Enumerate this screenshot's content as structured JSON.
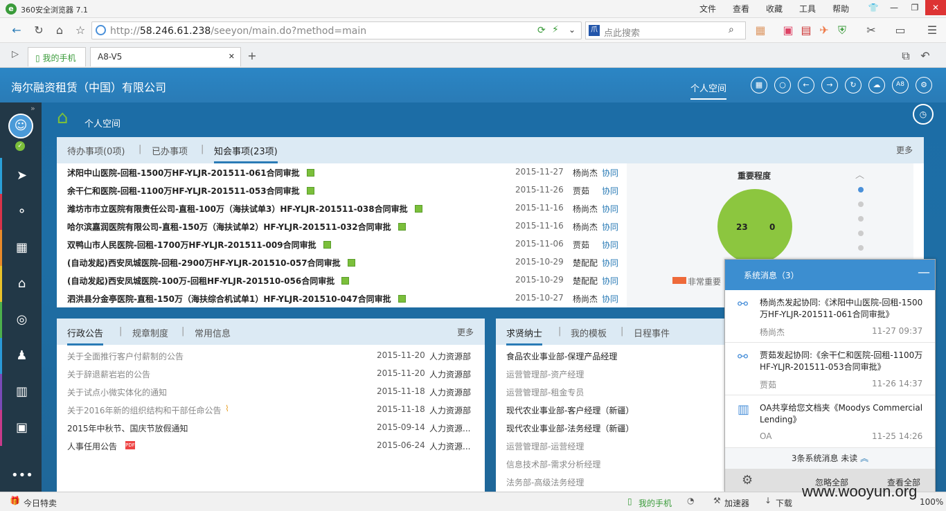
{
  "browser": {
    "title": "360安全浏览器 7.1",
    "menu": [
      "文件",
      "查看",
      "收藏",
      "工具",
      "帮助"
    ],
    "url_prefix": "http://",
    "url_host": "58.246.61.238",
    "url_path": "/seeyon/main.do?method=main",
    "search_placeholder": "点此搜索",
    "tabs": [
      "我的手机",
      "A8-V5"
    ]
  },
  "app": {
    "company": "海尔融资租赁（中国）有限公司",
    "nav_personal": "个人空间",
    "header_icons": [
      "grid-icon",
      "search-icon",
      "back-icon",
      "forward-icon",
      "refresh-icon",
      "cloud-icon",
      "a8-icon",
      "gear-icon"
    ],
    "a8_label": "A8"
  },
  "crumb": {
    "label": "个人空间"
  },
  "todo": {
    "tabs": [
      "待办事项(0项)",
      "已办事项",
      "知会事项(23项)"
    ],
    "more": "更多",
    "rows": [
      {
        "title": "沭阳中山医院-回租-1500万HF-YLJR-201511-061合同审批",
        "date": "2015-11-27",
        "person": "杨尚杰",
        "kind": "协同"
      },
      {
        "title": "余干仁和医院-回租-1100万HF-YLJR-201511-053合同审批",
        "date": "2015-11-26",
        "person": "贾茹",
        "kind": "协同"
      },
      {
        "title": "潍坊市市立医院有限责任公司-直租-100万（海扶试单3）HF-YLJR-201511-038合同审批",
        "date": "2015-11-16",
        "person": "杨尚杰",
        "kind": "协同"
      },
      {
        "title": "哈尔滨嘉润医院有限公司-直租-150万（海扶试单2）HF-YLJR-201511-032合同审批",
        "date": "2015-11-16",
        "person": "杨尚杰",
        "kind": "协同"
      },
      {
        "title": "双鸭山市人民医院-回租-1700万HF-YLJR-201511-009合同审批",
        "date": "2015-11-06",
        "person": "贾茹",
        "kind": "协同"
      },
      {
        "title": "(自动发起)西安凤城医院-回租-2900万HF-YLJR-201510-057合同审批",
        "date": "2015-10-29",
        "person": "楚配配",
        "kind": "协同"
      },
      {
        "title": "(自动发起)西安凤城医院-100万-回租HF-YLJR-201510-056合同审批",
        "date": "2015-10-29",
        "person": "楚配配",
        "kind": "协同"
      },
      {
        "title": "泗洪县分金亭医院-直租-150万（海扶综合机试单1）HF-YLJR-201510-047合同审批",
        "date": "2015-10-27",
        "person": "杨尚杰",
        "kind": "协同"
      }
    ]
  },
  "chart_data": {
    "type": "pie",
    "title": "重要程度",
    "values": [
      23,
      0
    ],
    "legend": [
      "非常重要"
    ],
    "colors": [
      "#8cc63f",
      "#ee6a3a"
    ]
  },
  "notices": {
    "tabs": [
      "行政公告",
      "规章制度",
      "常用信息"
    ],
    "more": "更多",
    "rows": [
      {
        "title": "关于全面推行客户付薪制的公告",
        "date": "2015-11-20",
        "dept": "人力资源部"
      },
      {
        "title": "关于辞退薪岩岩的公告",
        "date": "2015-11-20",
        "dept": "人力资源部"
      },
      {
        "title": "关于试点小微实体化的通知",
        "date": "2015-11-18",
        "dept": "人力资源部"
      },
      {
        "title": "关于2016年新的组织结构和干部任命公告",
        "date": "2015-11-18",
        "dept": "人力资源部"
      },
      {
        "title": "2015年中秋节、国庆节放假通知",
        "date": "2015-09-14",
        "dept": "人力资源..."
      },
      {
        "title": "人事任用公告",
        "date": "2015-06-24",
        "dept": "人力资源..."
      }
    ]
  },
  "recruit": {
    "tabs": [
      "求贤纳士",
      "我的模板",
      "日程事件"
    ],
    "rows": [
      "食品农业事业部-保理产品经理",
      "运营管理部-资产经理",
      "运营管理部-租金专员",
      "现代农业事业部-客户经理（新疆）",
      "现代农业事业部-法务经理（新疆）",
      "运营管理部-运营经理",
      "信息技术部-需求分析经理",
      "法务部-高级法务经理"
    ]
  },
  "sysmsg": {
    "title": "系统消息（3）",
    "items": [
      {
        "text": "杨尚杰发起协同:《沭阳中山医院-回租-1500万HF-YLJR-201511-061合同审批》",
        "who": "杨尚杰",
        "time": "11-27 09:37"
      },
      {
        "text": "贾茹发起协同:《余干仁和医院-回租-1100万HF-YLJR-201511-053合同审批》",
        "who": "贾茹",
        "time": "11-26 14:37"
      },
      {
        "text": "OA共享给您文档夹《Moodys Commercial Lending》",
        "who": "OA",
        "time": "11-25 14:26"
      }
    ],
    "unread": "3条系统消息 未读",
    "ignore": "忽略全部",
    "view": "查看全部"
  },
  "status": {
    "left": "今日特卖",
    "phone": "我的手机",
    "accel": "加速器",
    "download": "下载",
    "zoom": "100%",
    "watermark": "www.wooyun.org"
  }
}
